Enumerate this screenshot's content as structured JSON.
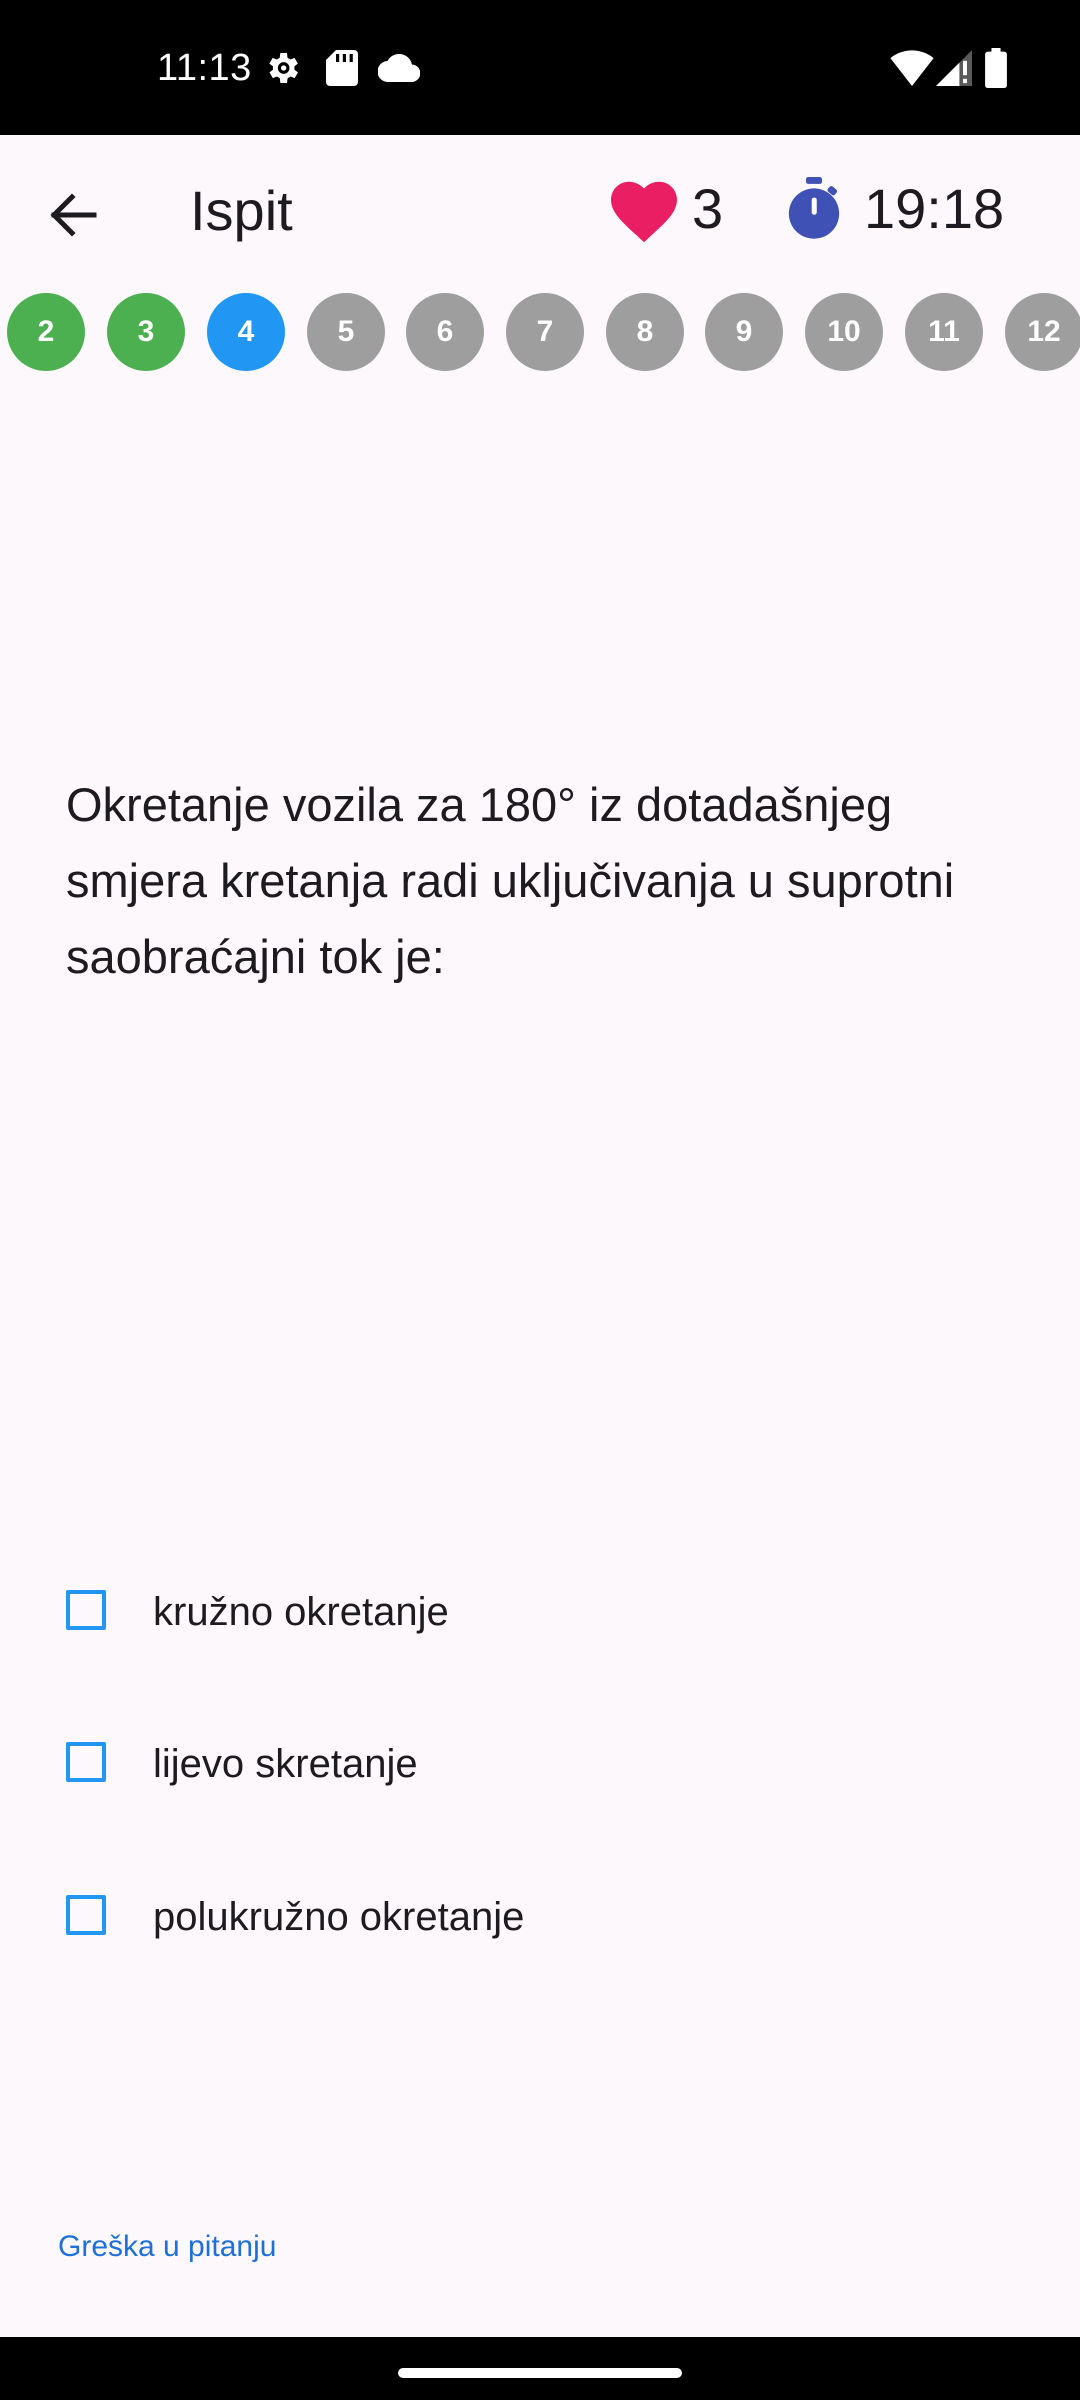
{
  "status_bar": {
    "time": "11:13",
    "left_icons": [
      "gear-icon",
      "sd-card-icon",
      "cloud-icon"
    ],
    "right_icons": [
      "wifi-icon",
      "signal-icon",
      "battery-icon"
    ]
  },
  "app_bar": {
    "title": "Ispit",
    "lives": "3",
    "timer": "19:18",
    "colors": {
      "heart": "#e91e63",
      "timer": "#3f51b5"
    }
  },
  "question_nav": {
    "items": [
      {
        "label": "2",
        "state": "answered"
      },
      {
        "label": "3",
        "state": "answered"
      },
      {
        "label": "4",
        "state": "current"
      },
      {
        "label": "5",
        "state": "pending"
      },
      {
        "label": "6",
        "state": "pending"
      },
      {
        "label": "7",
        "state": "pending"
      },
      {
        "label": "8",
        "state": "pending"
      },
      {
        "label": "9",
        "state": "pending"
      },
      {
        "label": "10",
        "state": "pending"
      },
      {
        "label": "11",
        "state": "pending"
      },
      {
        "label": "12",
        "state": "pending"
      }
    ],
    "colors": {
      "answered": "#4caf50",
      "current": "#2196f3",
      "pending": "#9e9e9e"
    }
  },
  "question": {
    "text": "Okretanje vozila za 180° iz dotadašnjeg smjera kretanja radi uključivanja u suprotni saobraćajni tok je:"
  },
  "options": [
    {
      "label": "kružno okretanje",
      "checked": false
    },
    {
      "label": "lijevo skretanje",
      "checked": false
    },
    {
      "label": "polukružno okretanje",
      "checked": false
    }
  ],
  "footer": {
    "report_link": "Greška u pitanju"
  }
}
